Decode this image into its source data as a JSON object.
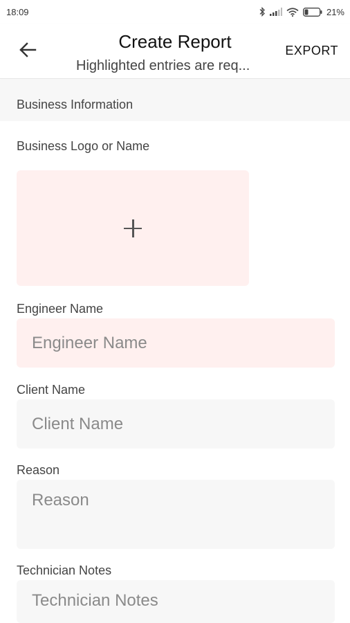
{
  "status_bar": {
    "time": "18:09",
    "battery": "21%"
  },
  "app_bar": {
    "title": "Create Report",
    "subtitle": "Highlighted entries are req...",
    "export_label": "EXPORT"
  },
  "section": {
    "title": "Business Information"
  },
  "fields": {
    "logo_label": "Business Logo or Name",
    "engineer_label": "Engineer Name",
    "engineer_placeholder": "Engineer Name",
    "client_label": "Client Name",
    "client_placeholder": "Client Name",
    "reason_label": "Reason",
    "reason_placeholder": "Reason",
    "notes_label": "Technician Notes",
    "notes_placeholder": "Technician Notes"
  },
  "colors": {
    "required_bg": "#fff0ef",
    "field_bg": "#f7f7f7"
  }
}
